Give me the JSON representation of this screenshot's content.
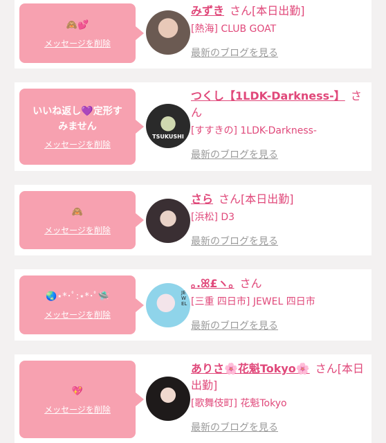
{
  "delete_label": "メッセージを削除",
  "blog_label": "最新のブログを見る",
  "san_label": "さん",
  "entries": [
    {
      "message": "🙈💕",
      "name": "みずき",
      "status": "[本日出勤]",
      "shop": "[熱海] CLUB GOAT",
      "avatar_text": ""
    },
    {
      "message": "いいね返し💜定形すみません",
      "name": "つくし【1LDK-Darkness-】",
      "status": "",
      "shop": "[すすきの] 1LDK-Darkness-",
      "avatar_text": "TSUKUSHI"
    },
    {
      "message": "🙈",
      "name": "さら",
      "status": "[本日出勤]",
      "shop": "[浜松] D3",
      "avatar_text": ""
    },
    {
      "message": "🌏⋆*･ﾟ:⋆*･ﾟ🛸",
      "name": "｡.ꕤ£ヽ｡",
      "status": "",
      "shop": "[三重 四日市] JEWEL 四日市",
      "avatar_text": "JEWEL"
    },
    {
      "message": "💖",
      "name": "ありさ🌸花魁Tokyo🌸",
      "status": "[本日出勤]",
      "shop": "[歌舞伎町] 花魁Tokyo",
      "avatar_text": ""
    }
  ],
  "colors": {
    "pink_accent": "#e0487a",
    "bubble": "#f7a1b0",
    "background": "#f3f1f1",
    "link_gray": "#9a9a9a"
  }
}
